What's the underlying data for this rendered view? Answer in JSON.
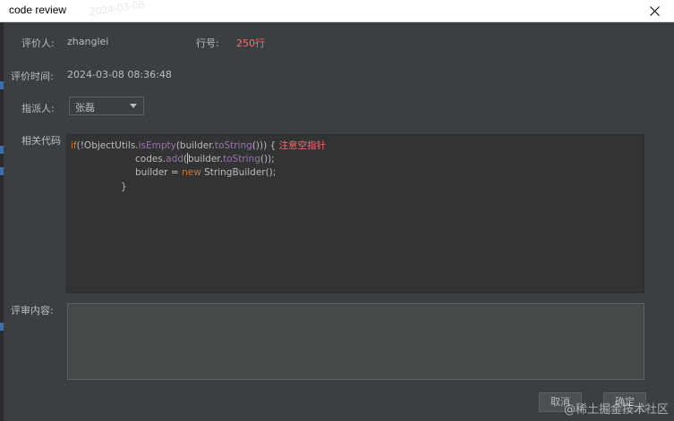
{
  "window": {
    "title": "code review",
    "title_watermark": "2024-03-08"
  },
  "form": {
    "reviewer_label": "评价人:",
    "reviewer_value": "zhanglei",
    "line_label": "行号:",
    "line_value": "250行",
    "time_label": "评价时间:",
    "time_value": "2024-03-08 08:36:48",
    "assignee_label": "指派人:",
    "assignee_selected": "张磊",
    "code_label": "相关代码",
    "review_label": "评审内容:",
    "review_value": ""
  },
  "code": {
    "line1": {
      "if_kw": "if",
      "part_a": "(!ObjectUtils.",
      "isEmpty": "isEmpty",
      "part_b": "(builder.",
      "toString": "toString",
      "part_c": "())) {",
      "note": "注意空指针"
    },
    "line2": {
      "part_a": "codes.",
      "add": "add",
      "part_b": "builder.",
      "toString": "toString",
      "part_c": "());"
    },
    "line3": {
      "part_a": "builder = ",
      "new_kw": "new",
      "part_b": " StringBuilder();"
    },
    "line4": "}"
  },
  "buttons": {
    "cancel": "取消",
    "ok": "确定"
  },
  "watermark": "@稀土掘金技术社区",
  "colors": {
    "background": "#3c3f41",
    "text": "#bbbbbb",
    "accent_red": "#ff6b68",
    "keyword_orange": "#cc7832",
    "method_purple": "#9876aa"
  },
  "icons": {
    "close": "close-icon",
    "dropdown": "chevron-down-icon"
  }
}
